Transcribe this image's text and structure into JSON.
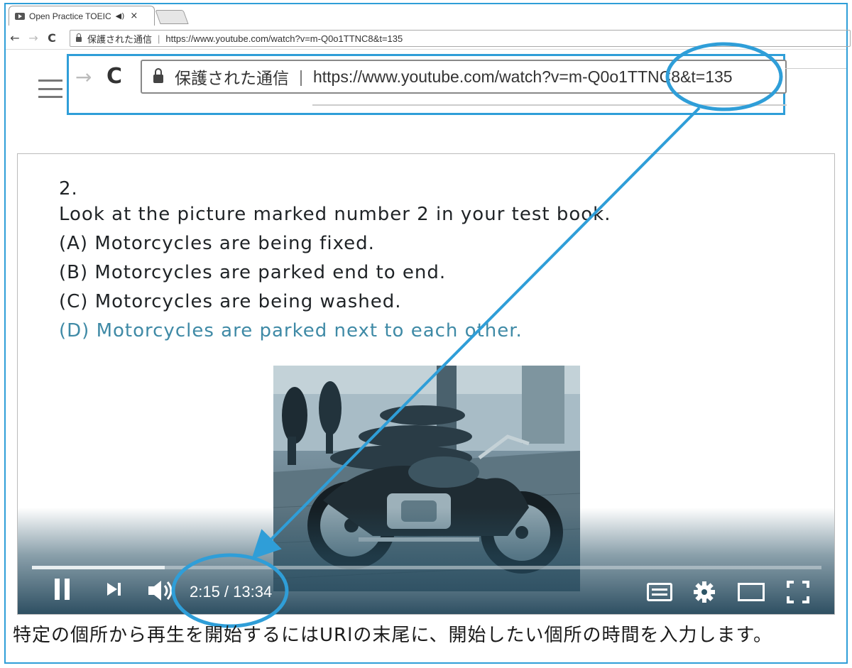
{
  "browser": {
    "tab_title": "Open Practice TOEIC",
    "tab_audio_icon": "speaker-icon",
    "tab_close": "×",
    "toolbar": {
      "back": "←",
      "forward": "→",
      "reload": "C",
      "secure_label": "保護された通信",
      "separator": "|",
      "url": "https://www.youtube.com/watch?v=m-Q0o1TTNC8&t=135"
    }
  },
  "zoomed_toolbar": {
    "forward": "→",
    "reload": "C",
    "secure_label": "保護された通信",
    "separator": "|",
    "url": "https://www.youtube.com/watch?v=m-Q0o1TTNC8&t=135"
  },
  "video": {
    "question_number": "2.",
    "prompt": "Look at the picture marked number 2 in your test book.",
    "options": [
      "(A) Motorcycles are being fixed.",
      "(B) Motorcycles are parked end to end.",
      "(C) Motorcycles are being washed.",
      "(D) Motorcycles are parked next to each other."
    ],
    "time_display": "2:15 / 13:34",
    "progress": 0.168,
    "controls": [
      "pause-icon",
      "next-icon",
      "volume-icon",
      "subtitles-icon",
      "settings-icon",
      "theater-icon",
      "fullscreen-icon"
    ]
  },
  "annotation": {
    "color": "#2f9ed8"
  },
  "caption": "特定の個所から再生を開始するにはURlの末尾に、開始したい個所の時間を入力します。"
}
